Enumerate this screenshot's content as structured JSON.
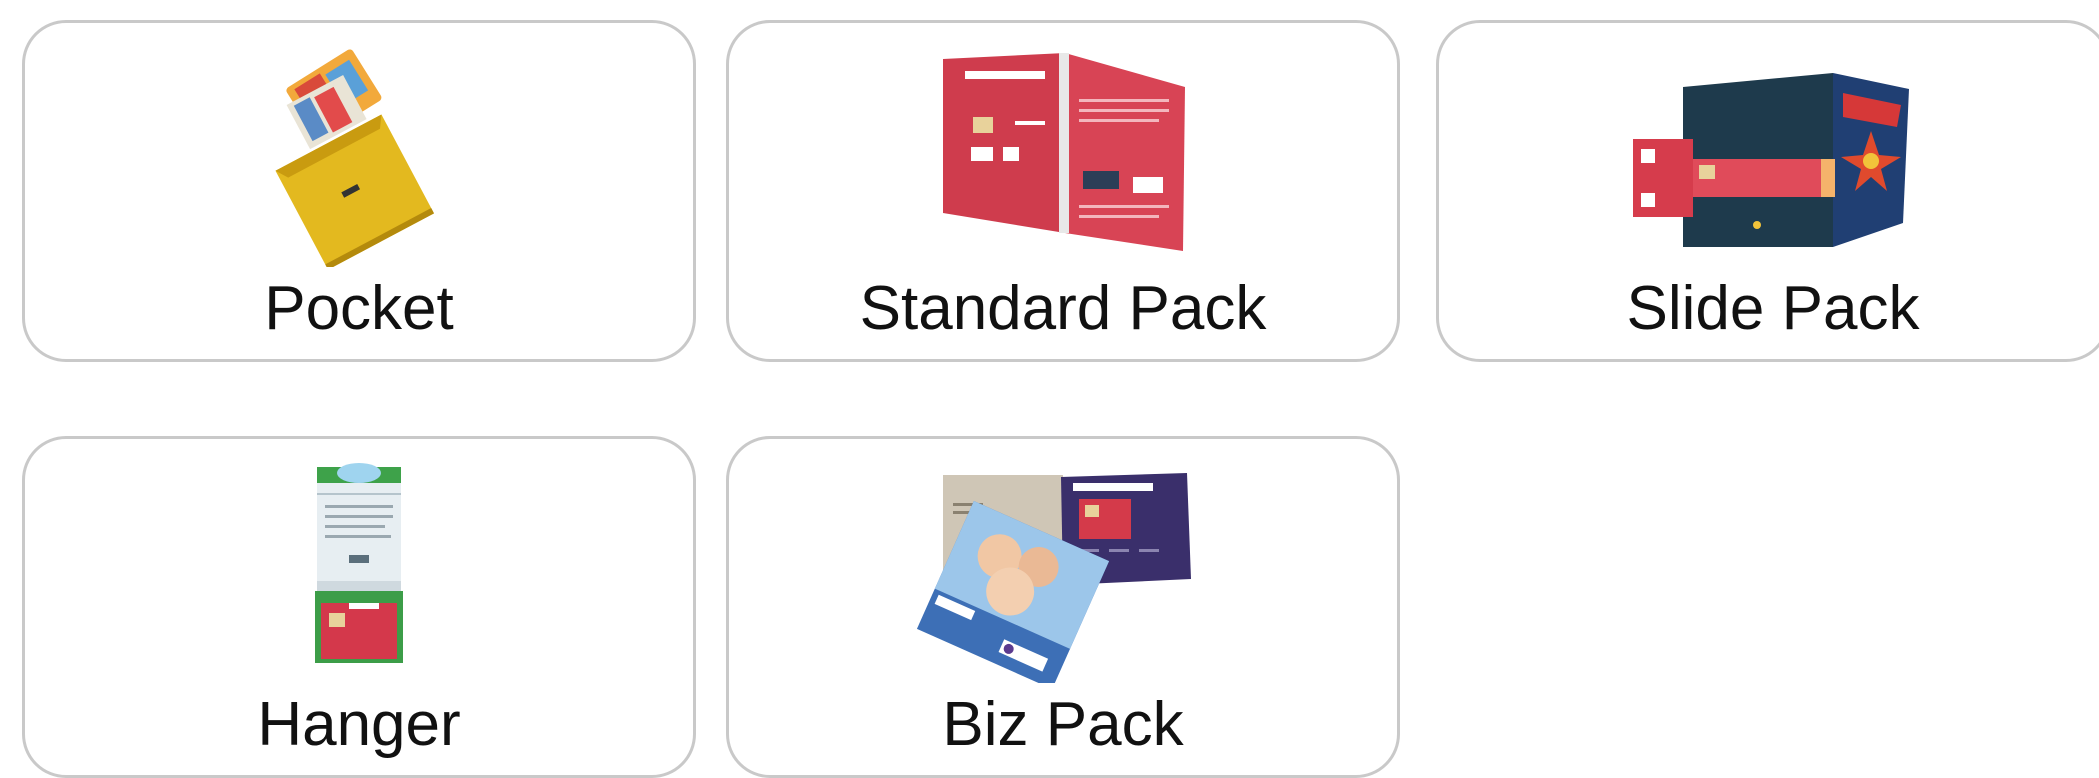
{
  "packaging_options": [
    {
      "label": "Pocket",
      "icon": "pocket-package-image"
    },
    {
      "label": "Standard Pack",
      "icon": "standard-pack-image"
    },
    {
      "label": "Slide Pack",
      "icon": "slide-pack-image"
    },
    {
      "label": "Hanger",
      "icon": "hanger-package-image"
    },
    {
      "label": "Biz Pack",
      "icon": "biz-pack-image"
    }
  ],
  "colors": {
    "card_border": "#c9c9c9",
    "label_text": "#111111"
  }
}
